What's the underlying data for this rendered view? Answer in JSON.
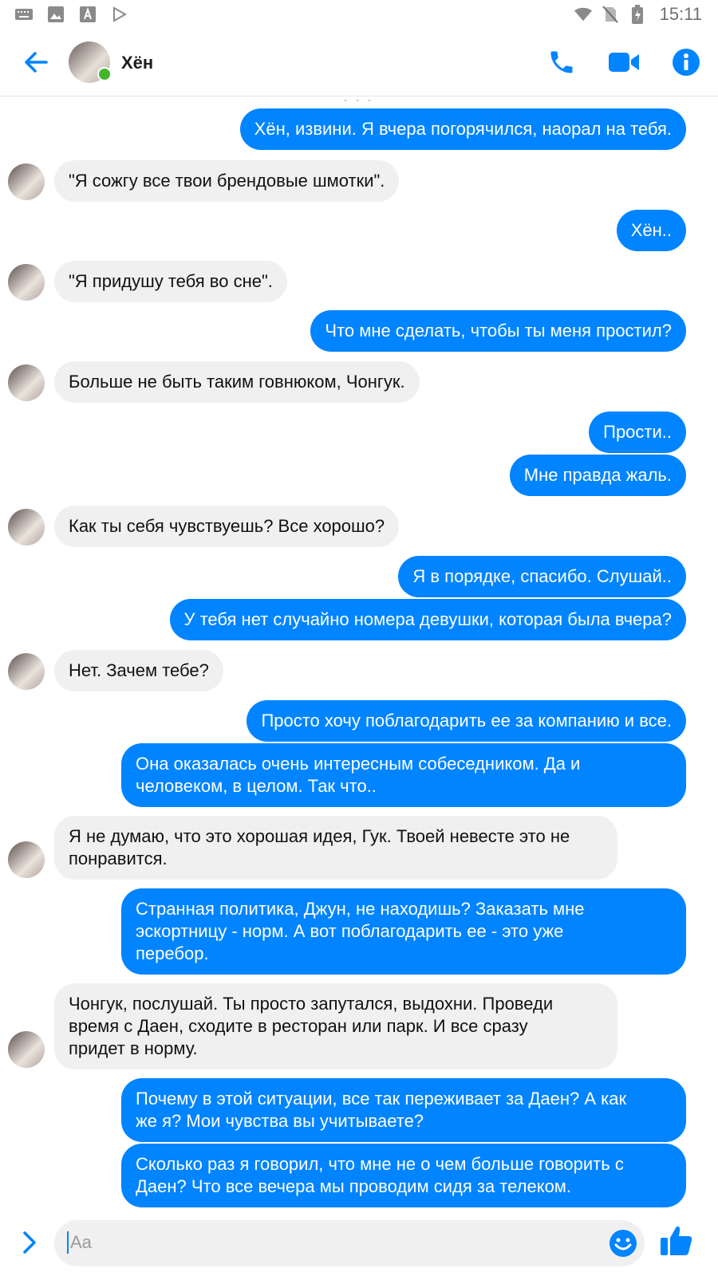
{
  "statusbar": {
    "time": "15:11",
    "icons": [
      "keyboard-icon",
      "image-icon",
      "font-icon",
      "play-store-icon",
      "wifi-icon",
      "no-sim-icon",
      "battery-icon"
    ]
  },
  "header": {
    "contact_name": "Хён",
    "online": true,
    "icons": [
      "back-arrow-icon",
      "phone-icon",
      "video-icon",
      "info-icon"
    ],
    "accent_color": "#0084ff"
  },
  "messages": [
    {
      "dir": "out",
      "text": "Хён, извини. Я вчера погорячился, наорал на тебя."
    },
    {
      "dir": "in",
      "text": "\"Я сожгу все твои брендовые шмотки\"."
    },
    {
      "dir": "out",
      "text": "Хён.."
    },
    {
      "dir": "in",
      "text": "\"Я придушу тебя во сне\"."
    },
    {
      "dir": "out",
      "text": "Что мне сделать, чтобы ты меня простил?"
    },
    {
      "dir": "in",
      "text": "Больше не быть таким говнюком, Чонгук."
    },
    {
      "dir": "out",
      "text": "Прости.."
    },
    {
      "dir": "out",
      "text": "Мне правда жаль."
    },
    {
      "dir": "in",
      "text": "Как ты себя чувствуешь? Все хорошо?"
    },
    {
      "dir": "out",
      "text": "Я в порядке, спасибо. Слушай.."
    },
    {
      "dir": "out",
      "text": "У тебя нет случайно номера девушки, которая была вчера?"
    },
    {
      "dir": "in",
      "text": "Нет. Зачем тебе?"
    },
    {
      "dir": "out",
      "text": "Просто хочу поблагодарить ее за компанию и все."
    },
    {
      "dir": "out",
      "text": "Она оказалась очень интересным собеседником. Да и\nчеловеком, в целом. Так что.."
    },
    {
      "dir": "in",
      "text": "Я не думаю, что это хорошая идея, Гук. Твоей невесте это не\nпонравится."
    },
    {
      "dir": "out",
      "text": "Странная политика, Джун, не находишь? Заказать мне\nэскортницу - норм. А вот поблагодарить ее - это уже\nперебор."
    },
    {
      "dir": "in",
      "text": "Чонгук, послушай. Ты просто запутался, выдохни. Проведи\nвремя с Даен, сходите в ресторан или парк. И все сразу\nпридет в норму."
    },
    {
      "dir": "out",
      "text": "Почему в этой ситуации, все так переживает за Даен? А как\nже я? Мои чувства вы учитываете?"
    },
    {
      "dir": "out",
      "text": "Сколько раз я говорил, что мне не о чем больше говорить с\nДаен? Что все вечера мы проводим сидя за телеком."
    }
  ],
  "composer": {
    "placeholder": "Aa",
    "icons": [
      "chevron-right-icon",
      "emoji-icon",
      "like-thumb-icon"
    ]
  }
}
